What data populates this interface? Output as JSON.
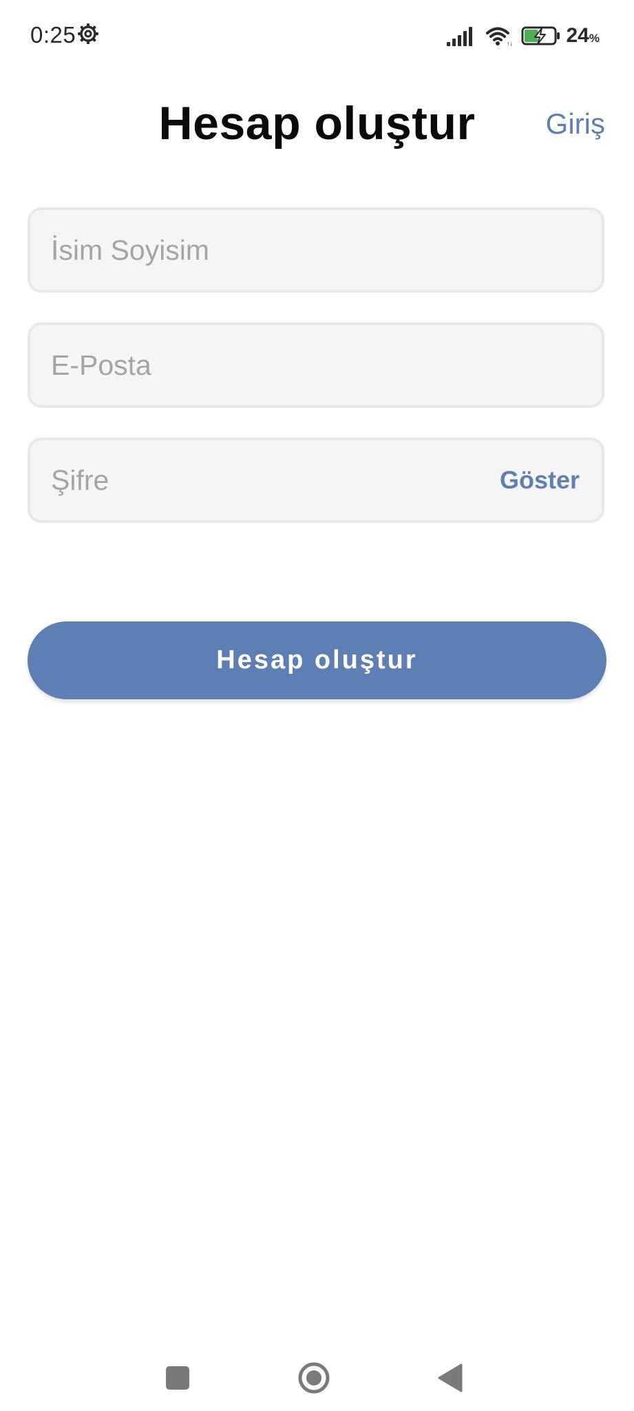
{
  "status_bar": {
    "time": "0:25",
    "settings_icon": "gear-icon",
    "signal_icon": "cellular-signal-icon",
    "wifi_icon": "wifi-icon",
    "battery_icon": "battery-charging-icon",
    "battery_percent": "24",
    "battery_percent_symbol": "%",
    "battery_level": 0.24,
    "battery_fill_color": "#4caf50"
  },
  "header": {
    "title": "Hesap oluştur",
    "login_link": "Giriş"
  },
  "form": {
    "name_field": {
      "placeholder": "İsim Soyisim",
      "value": ""
    },
    "email_field": {
      "placeholder": "E-Posta",
      "value": ""
    },
    "password_field": {
      "placeholder": "Şifre",
      "value": "",
      "toggle_label": "Göster"
    },
    "submit_label": "Hesap oluştur"
  },
  "navigation_bar": {
    "recents_icon": "square-recents-icon",
    "home_icon": "circle-home-icon",
    "back_icon": "triangle-back-icon"
  },
  "colors": {
    "accent": "#5e7fb3",
    "link": "#5d7fb2",
    "field_background": "#f5f5f5",
    "field_border": "#e8e8e8",
    "placeholder": "#a4a4a4",
    "title": "#0a0a0a"
  }
}
